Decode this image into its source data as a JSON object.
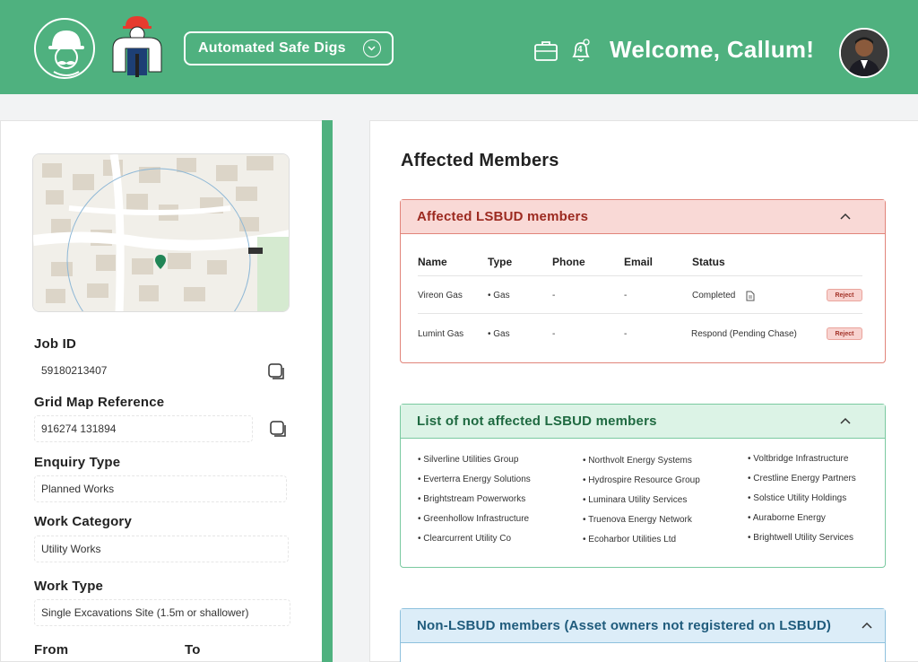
{
  "header": {
    "app_name": "Automated Safe Digs",
    "welcome": "Welcome, Callum!",
    "notification_count": "4",
    "accent": "#4fb17f"
  },
  "form": {
    "job_id": {
      "label": "Job ID",
      "value": "59180213407"
    },
    "grid_ref": {
      "label": "Grid Map Reference",
      "value": "916274 131894"
    },
    "enquiry_type": {
      "label": "Enquiry Type",
      "value": "Planned Works"
    },
    "work_category": {
      "label": "Work Category",
      "value": "Utility Works"
    },
    "work_type": {
      "label": "Work Type",
      "value": "Single Excavations Site (1.5m or shallower)"
    },
    "from_label": "From",
    "to_label": "To"
  },
  "main": {
    "title": "Affected Members",
    "affected": {
      "title": "Affected LSBUD members",
      "columns": [
        "Name",
        "Type",
        "Phone",
        "Email",
        "Status"
      ],
      "rows": [
        {
          "name": "Vireon Gas",
          "type": "• Gas",
          "phone": "-",
          "email": "-",
          "status": "Completed",
          "action": "Reject"
        },
        {
          "name": "Lumint Gas",
          "type": "• Gas",
          "phone": "-",
          "email": "-",
          "status": "Respond (Pending Chase)",
          "action": "Reject"
        }
      ]
    },
    "not_affected": {
      "title": "List of not affected LSBUD members",
      "col1": [
        "• Silverline Utilities Group",
        "• Everterra Energy Solutions",
        "• Brightstream Powerworks",
        "• Greenhollow Infrastructure",
        "• Clearcurrent Utility Co"
      ],
      "col2": [
        "• Northvolt Energy Systems",
        "• Hydrospire Resource Group",
        "• Luminara Utility Services",
        "• Truenova Energy Network",
        "• Ecoharbor Utilities Ltd"
      ],
      "col3": [
        "• Voltbridge Infrastructure",
        "• Crestline Energy Partners",
        "• Solstice Utility Holdings",
        "• Auraborne Energy",
        "• Brightwell Utility Services"
      ]
    },
    "non_lsbud": {
      "title": "Non-LSBUD members (Asset owners not registered on LSBUD)"
    }
  }
}
